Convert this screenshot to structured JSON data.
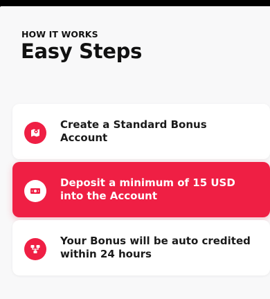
{
  "header": {
    "eyebrow": "HOW IT WORKS",
    "title": "Easy Steps"
  },
  "steps": [
    {
      "label": "Create a Standard Bonus Account",
      "icon": "map-pin-icon",
      "active": false
    },
    {
      "label": "Deposit a minimum of 15 USD into the Account",
      "icon": "cash-icon",
      "active": true
    },
    {
      "label": "Your Bonus will be auto credited within 24 hours",
      "icon": "flow-icon",
      "active": false
    }
  ],
  "colors": {
    "accent": "#ef1f44",
    "background": "#f8f8f9",
    "card": "#ffffff",
    "text": "#1a1a1a"
  }
}
